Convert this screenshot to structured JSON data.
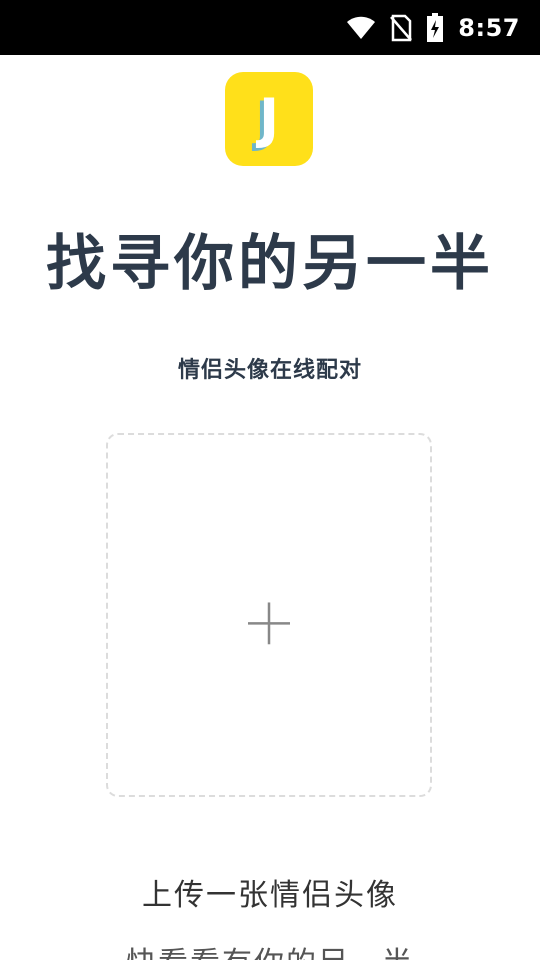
{
  "status_bar": {
    "time": "8:57",
    "icons": [
      "wifi-icon",
      "no-sim-icon",
      "battery-charging-icon"
    ]
  },
  "app": {
    "logo_letter": "J",
    "logo_color": "#FFE01A"
  },
  "main": {
    "title": "找寻你的另一半",
    "subtitle": "情侣头像在线配对",
    "upload_icon": "plus-icon",
    "upload_label": "上传一张情侣头像",
    "hint": "快看看有你的另一半"
  },
  "colors": {
    "title_text": "#2d3a4a",
    "status_bar_bg": "#000000",
    "dashed_border": "#dcdcdc"
  }
}
